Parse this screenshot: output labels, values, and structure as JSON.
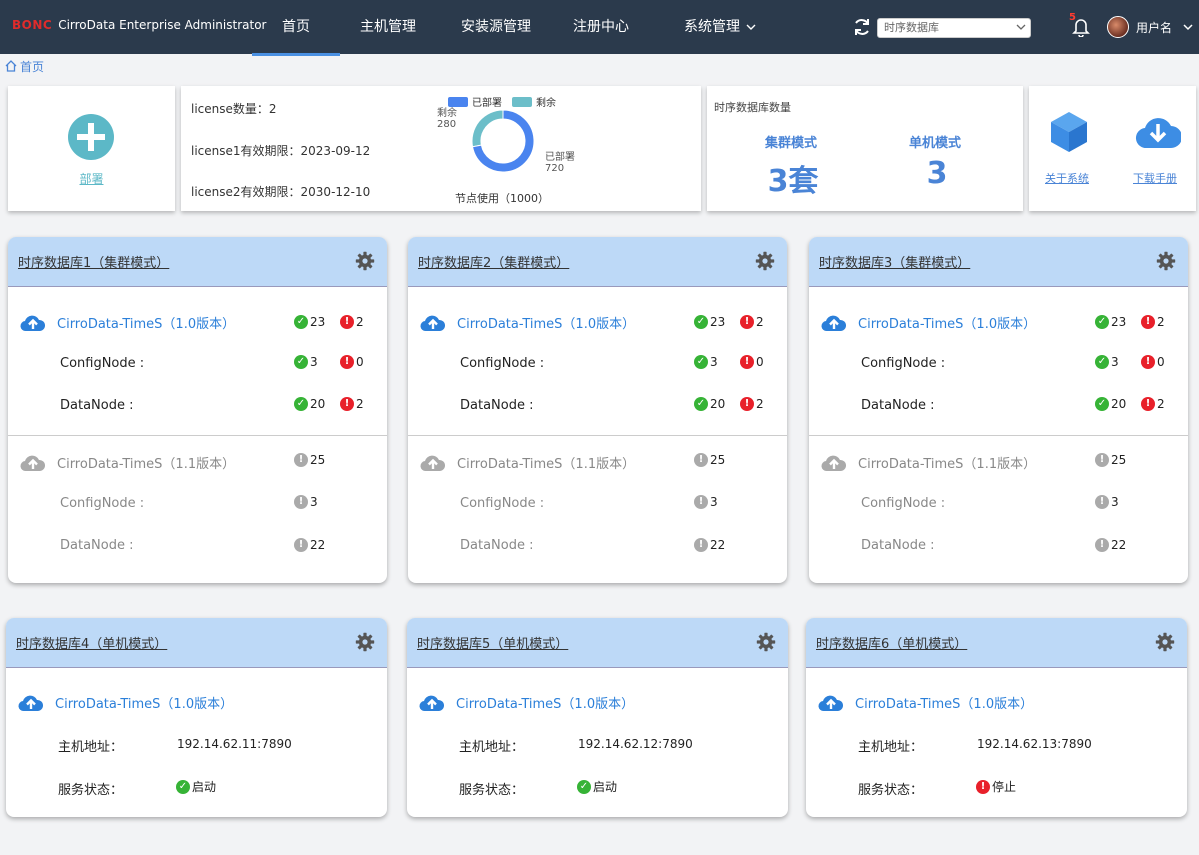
{
  "brand": {
    "logo": "BONC",
    "title": "CirroData Enterprise Administrator"
  },
  "nav": [
    "首页",
    "主机管理",
    "安装源管理",
    "注册中心",
    "系统管理"
  ],
  "header": {
    "db_select": "时序数据库",
    "notif_count": "5",
    "username": "用户名"
  },
  "breadcrumb": "首页",
  "deploy": {
    "label": "部署"
  },
  "license": {
    "count": "license数量：2",
    "l1": "license1有效期限：2023-09-12",
    "l2": "license2有效期限：2030-12-10",
    "legend_used": "已部署",
    "legend_left": "剩余",
    "used_label": "已部署",
    "used_value": "720",
    "left_label": "剩余",
    "left_value": "280",
    "caption": "节点使用（1000）"
  },
  "chart_data": {
    "type": "pie",
    "categories": [
      "已部署",
      "剩余"
    ],
    "values": [
      720,
      280
    ],
    "title": "节点使用（1000）"
  },
  "dbcount": {
    "title": "时序数据库数量",
    "cluster_label": "集群模式",
    "cluster_value": "3套",
    "single_label": "单机模式",
    "single_value": "3"
  },
  "links": {
    "about": "关于系统",
    "manual": "下载手册"
  },
  "labels": {
    "config": "ConfigNode :",
    "data": "DataNode :",
    "host": "主机地址：",
    "status": "服务状态："
  },
  "clusters": [
    {
      "title": "时序数据库1（集群模式）",
      "v1": {
        "name": "CirroData-TimeS（1.0版本）",
        "ok": "23",
        "err": "2",
        "cfg_ok": "3",
        "cfg_err": "0",
        "dn_ok": "20",
        "dn_err": "2"
      },
      "v2": {
        "name": "CirroData-TimeS（1.1版本）",
        "total": "25",
        "cfg": "3",
        "dn": "22"
      }
    },
    {
      "title": "时序数据库2（集群模式）",
      "v1": {
        "name": "CirroData-TimeS（1.0版本）",
        "ok": "23",
        "err": "2",
        "cfg_ok": "3",
        "cfg_err": "0",
        "dn_ok": "20",
        "dn_err": "2"
      },
      "v2": {
        "name": "CirroData-TimeS（1.1版本）",
        "total": "25",
        "cfg": "3",
        "dn": "22"
      }
    },
    {
      "title": "时序数据库3（集群模式）",
      "v1": {
        "name": "CirroData-TimeS（1.0版本）",
        "ok": "23",
        "err": "2",
        "cfg_ok": "3",
        "cfg_err": "0",
        "dn_ok": "20",
        "dn_err": "2"
      },
      "v2": {
        "name": "CirroData-TimeS（1.1版本）",
        "total": "25",
        "cfg": "3",
        "dn": "22"
      }
    }
  ],
  "singles": [
    {
      "title": "时序数据库4（单机模式）",
      "name": "CirroData-TimeS（1.0版本）",
      "host": "192.14.62.11:7890",
      "status": "启动",
      "state": "ok"
    },
    {
      "title": "时序数据库5（单机模式）",
      "name": "CirroData-TimeS（1.0版本）",
      "host": "192.14.62.12:7890",
      "status": "启动",
      "state": "ok"
    },
    {
      "title": "时序数据库6（单机模式）",
      "name": "CirroData-TimeS（1.0版本）",
      "host": "192.14.62.13:7890",
      "status": "停止",
      "state": "err"
    }
  ],
  "colors": {
    "accent": "#4a84d6",
    "topbar": "#2b3a4c",
    "used": "#4a84ef",
    "left": "#6cbec9",
    "ok": "#36b336",
    "err": "#e8202a"
  }
}
